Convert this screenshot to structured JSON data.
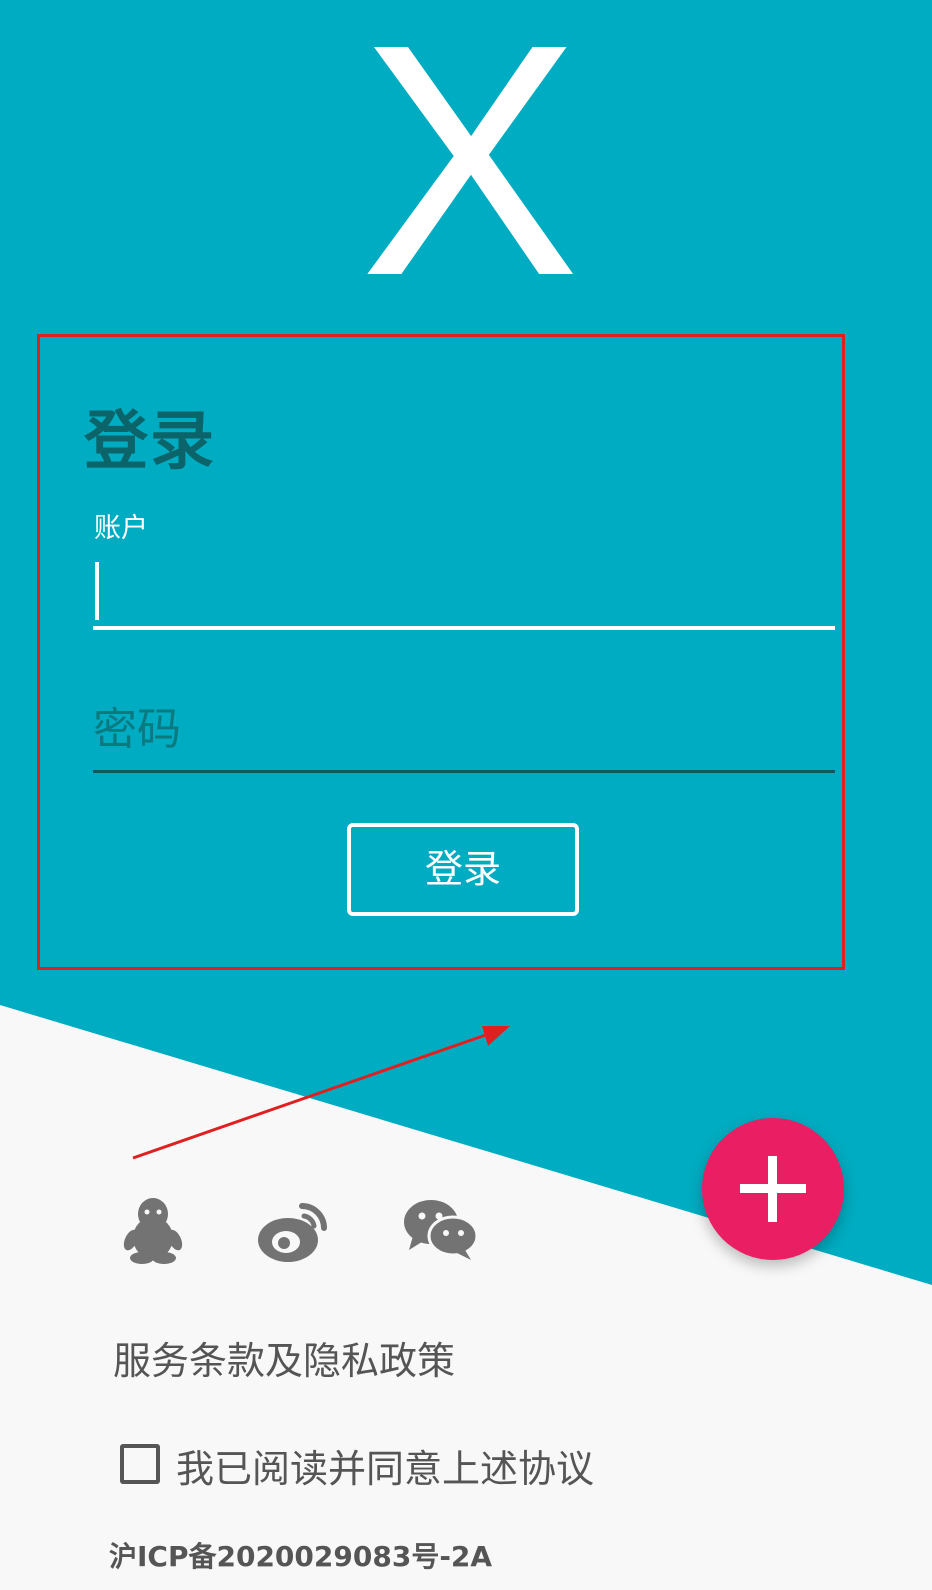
{
  "colors": {
    "primary": "#00acc1",
    "background": "#f8f8f8",
    "accent": "#e91e63",
    "title": "#0b6469",
    "annotation": "#e02020"
  },
  "logo": {
    "text": "X"
  },
  "login": {
    "title": "登录",
    "account_label": "账户",
    "account_value": "",
    "password_placeholder": "密码",
    "submit_label": "登录"
  },
  "fab": {
    "icon": "plus-icon"
  },
  "social": {
    "icons": [
      "qq-icon",
      "weibo-icon",
      "wechat-icon"
    ]
  },
  "footer": {
    "terms_link": "服务条款及隐私政策",
    "agree_label": "我已阅读并同意上述协议",
    "agree_checked": false,
    "icp": "沪ICP备2020029083号-2A"
  }
}
